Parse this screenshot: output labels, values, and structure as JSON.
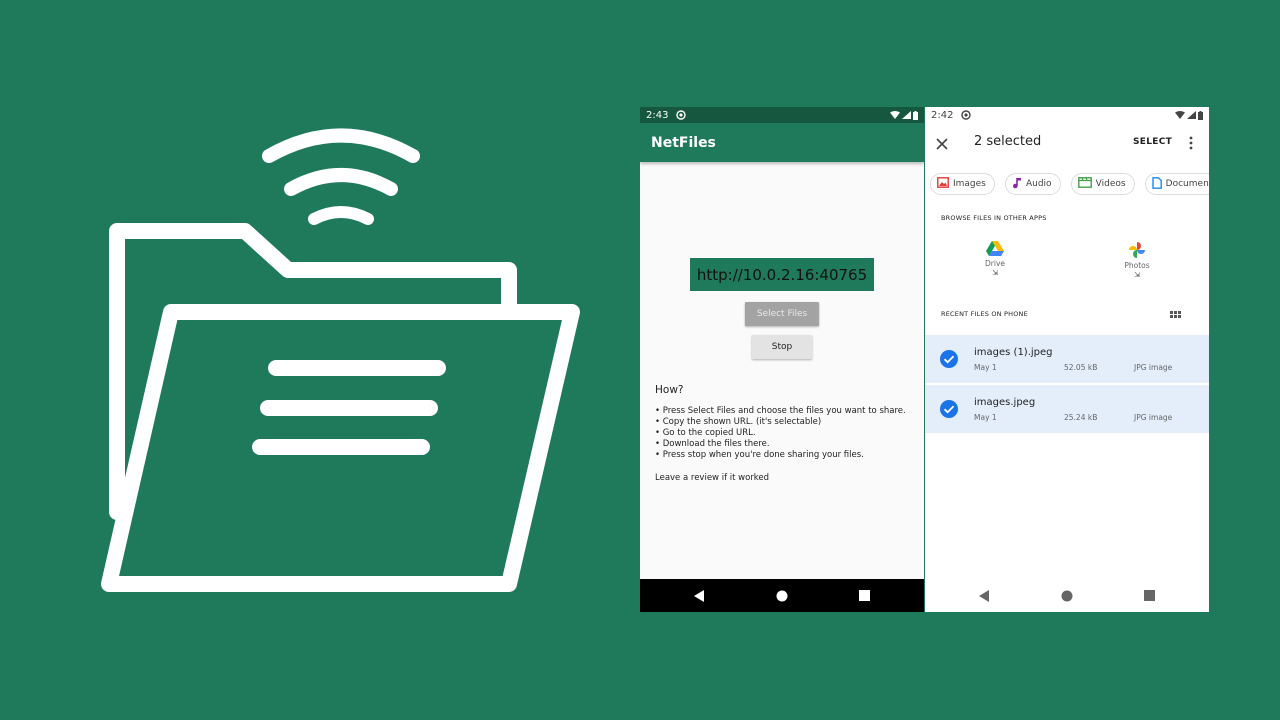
{
  "colors": {
    "background": "#1f7a5c",
    "statusbar_dark": "#16573f",
    "selected_row": "#e3eefa",
    "accent_blue": "#1a73e8"
  },
  "netfiles_phone": {
    "status": {
      "time": "2:43"
    },
    "app_title": "NetFiles",
    "url": "http://10.0.2.16:40765",
    "select_files_label": "Select Files",
    "stop_label": "Stop",
    "how_title": "How?",
    "instructions": [
      "• Press Select Files and choose the files you want to share.",
      "• Copy the shown URL. (it's selectable)",
      "• Go to the copied URL.",
      "• Download the files there.",
      "• Press stop when you're done sharing your files."
    ],
    "review_text": "Leave a review if it worked"
  },
  "picker_phone": {
    "status": {
      "time": "2:42"
    },
    "title": "2 selected",
    "select_action": "SELECT",
    "chips": [
      {
        "label": "Images",
        "icon": "image-icon",
        "color": "#e53935"
      },
      {
        "label": "Audio",
        "icon": "music-note-icon",
        "color": "#8e24aa"
      },
      {
        "label": "Videos",
        "icon": "video-icon",
        "color": "#43a047"
      },
      {
        "label": "Documents",
        "icon": "document-icon",
        "color": "#1e88e5"
      }
    ],
    "browse_label": "BROWSE FILES IN OTHER APPS",
    "apps": [
      {
        "name": "Drive",
        "icon": "google-drive-icon"
      },
      {
        "name": "Photos",
        "icon": "google-photos-icon"
      }
    ],
    "recent_label": "RECENT FILES ON PHONE",
    "files": [
      {
        "name": "images (1).jpeg",
        "date": "May 1",
        "size": "52.05 kB",
        "type": "JPG image",
        "selected": true
      },
      {
        "name": "images.jpeg",
        "date": "May 1",
        "size": "25.24 kB",
        "type": "JPG image",
        "selected": true
      }
    ]
  }
}
